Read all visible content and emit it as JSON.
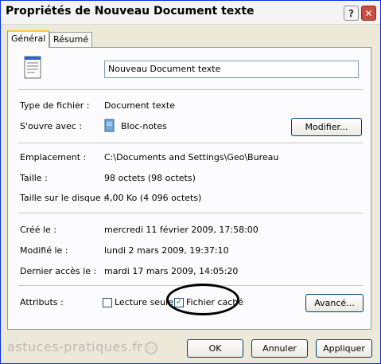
{
  "window": {
    "title": "Propriétés de Nouveau Document texte"
  },
  "titlebar_buttons": {
    "help": "?",
    "close": "✕"
  },
  "tabs": [
    {
      "label": "Général"
    },
    {
      "label": "Résumé"
    }
  ],
  "general": {
    "name_value": "Nouveau Document texte",
    "type_label": "Type de fichier :",
    "type_value": "Document texte",
    "opens_label": "S'ouvre avec :",
    "opens_value": "Bloc-notes",
    "modify_button": "Modifier...",
    "location_label": "Emplacement :",
    "location_value": "C:\\Documents and Settings\\Geo\\Bureau",
    "size_label": "Taille :",
    "size_value": "98 octets (98 octets)",
    "disk_size_label": "Taille sur le disque :",
    "disk_size_value": "4,00 Ko (4 096 octets)",
    "created_label": "Créé le :",
    "created_value": "mercredi 11 février 2009, 17:58:00",
    "modified_label": "Modifié le :",
    "modified_value": "lundi 2 mars 2009, 19:37:10",
    "accessed_label": "Dernier accès le :",
    "accessed_value": "mardi 17 mars 2009, 14:05:20",
    "attributes_label": "Attributs :",
    "readonly_label": "Lecture seule",
    "readonly_checked": false,
    "hidden_label": "Fichier caché",
    "hidden_checked": true,
    "advanced_button": "Avancé..."
  },
  "footer": {
    "ok": "OK",
    "cancel": "Annuler",
    "apply": "Appliquer"
  },
  "watermark": {
    "text": "astuces-pratiques.fr",
    "icon": "cc-icon"
  },
  "colors": {
    "titlebar_close": "#c64f3f",
    "tab_highlight": "#ffc83c",
    "checkbox_check": "#21a121"
  }
}
